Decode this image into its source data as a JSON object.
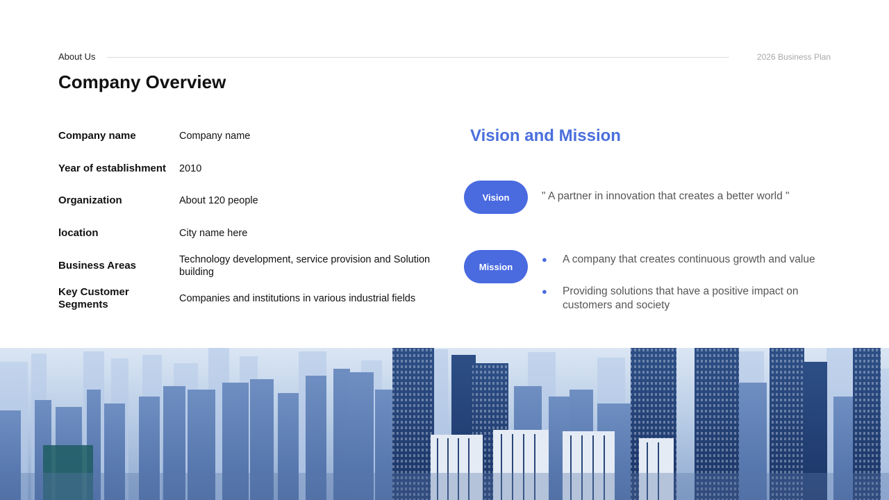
{
  "header": {
    "section_label": "About Us",
    "plan_label": "2026 Business  Plan"
  },
  "title": "Company Overview",
  "overview": {
    "rows": [
      {
        "label": "Company name",
        "value": "Company name"
      },
      {
        "label": "Year of establishment",
        "value": "2010"
      },
      {
        "label": "Organization",
        "value": "About 120 people"
      },
      {
        "label": "location",
        "value": "City name here"
      },
      {
        "label": "Business Areas",
        "value": "Technology development, service provision and Solution building"
      },
      {
        "label": "Key Customer Segments",
        "value": "Companies and institutions in various industrial fields"
      }
    ]
  },
  "vision_mission": {
    "title": "Vision and Mission",
    "vision_label": "Vision",
    "vision_text": "\" A partner in innovation that creates a better world \"",
    "mission_label": "Mission",
    "mission_items": [
      "A company that creates continuous growth and value",
      "Providing solutions  that have a positive  impact on customers and society"
    ]
  },
  "colors": {
    "accent": "#4a6ae0",
    "title_accent": "#4a6fdc"
  },
  "image": {
    "subject": "city-skyline"
  }
}
